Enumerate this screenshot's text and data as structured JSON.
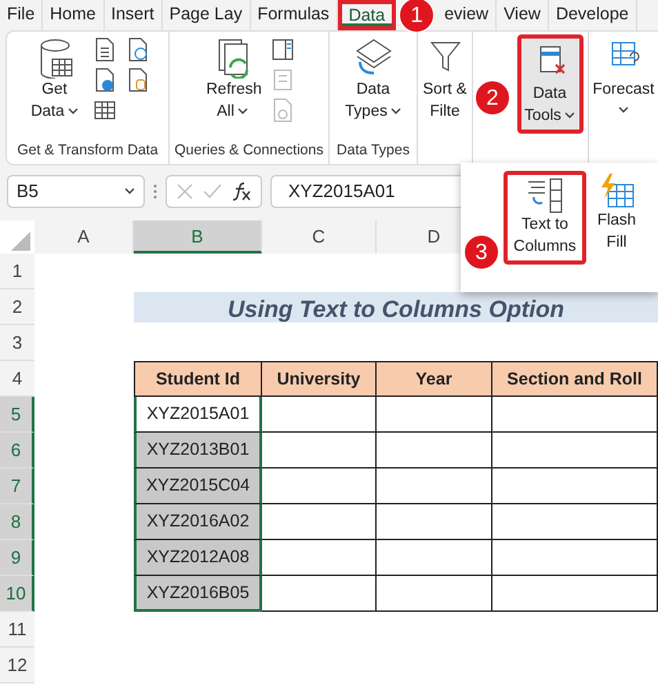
{
  "tabs": [
    {
      "label": "File",
      "selected": false,
      "highlighted": false
    },
    {
      "label": "Home",
      "selected": false,
      "highlighted": false
    },
    {
      "label": "Insert",
      "selected": false,
      "highlighted": false
    },
    {
      "label": "Page Lay",
      "selected": false,
      "highlighted": false
    },
    {
      "label": "Formulas",
      "selected": false,
      "highlighted": false
    },
    {
      "label": "Data",
      "selected": true,
      "highlighted": true
    },
    {
      "label": "eview",
      "selected": false,
      "highlighted": false
    },
    {
      "label": "View",
      "selected": false,
      "highlighted": false
    },
    {
      "label": "Develope",
      "selected": false,
      "highlighted": false
    }
  ],
  "ribbon_groups": [
    {
      "kind": "get-transform",
      "label": "Get & Transform Data",
      "button": {
        "label": "Get Data",
        "dropdown": true,
        "highlighted": false,
        "expanded": false
      }
    },
    {
      "kind": "queries",
      "label": "Queries & Connections",
      "button": {
        "label": "Refresh All",
        "dropdown": true,
        "highlighted": false,
        "expanded": false
      }
    },
    {
      "kind": "types",
      "label": "Data Types",
      "button": {
        "label": "Data Types",
        "dropdown": true,
        "highlighted": false,
        "expanded": false
      }
    },
    {
      "kind": "sort",
      "button": {
        "label": "Sort & Filte",
        "dropdown": false,
        "highlighted": false,
        "expanded": false
      }
    },
    {
      "kind": "tools",
      "button": {
        "label": "Data Tools",
        "dropdown": true,
        "highlighted": true,
        "expanded": true
      }
    },
    {
      "kind": "forecast",
      "button": {
        "label": "Forecast",
        "dropdown": true,
        "highlighted": false,
        "expanded": false
      }
    }
  ],
  "data_tools_menu": [
    {
      "kind": "text-to-columns",
      "label": "Text to Columns",
      "highlighted": true
    },
    {
      "kind": "flash-fill",
      "label": "Flash Fill",
      "highlighted": false
    }
  ],
  "callouts": [
    "1",
    "2",
    "3"
  ],
  "name_box": "B5",
  "formula": "XYZ2015A01",
  "columns": [
    {
      "label": "A",
      "selected": false
    },
    {
      "label": "B",
      "selected": true
    },
    {
      "label": "C",
      "selected": false
    },
    {
      "label": "D",
      "selected": false
    }
  ],
  "rows": [
    {
      "label": "1",
      "selected": false
    },
    {
      "label": "2",
      "selected": false
    },
    {
      "label": "3",
      "selected": false
    },
    {
      "label": "4",
      "selected": false
    },
    {
      "label": "5",
      "selected": true
    },
    {
      "label": "6",
      "selected": true
    },
    {
      "label": "7",
      "selected": true
    },
    {
      "label": "8",
      "selected": true
    },
    {
      "label": "9",
      "selected": true
    },
    {
      "label": "10",
      "selected": true
    },
    {
      "label": "11",
      "selected": false
    },
    {
      "label": "12",
      "selected": false
    }
  ],
  "title": "Using Text to Columns Option",
  "table": {
    "columns": [
      "Student Id",
      "University",
      "Year",
      "Section and Roll"
    ],
    "rows": [
      {
        "student_id": "XYZ2015A01",
        "active": true
      },
      {
        "student_id": "XYZ2013B01",
        "active": false
      },
      {
        "student_id": "XYZ2015C04",
        "active": false
      },
      {
        "student_id": "XYZ2016A02",
        "active": false
      },
      {
        "student_id": "XYZ2012A08",
        "active": false
      },
      {
        "student_id": "XYZ2016B05",
        "active": false
      }
    ]
  }
}
